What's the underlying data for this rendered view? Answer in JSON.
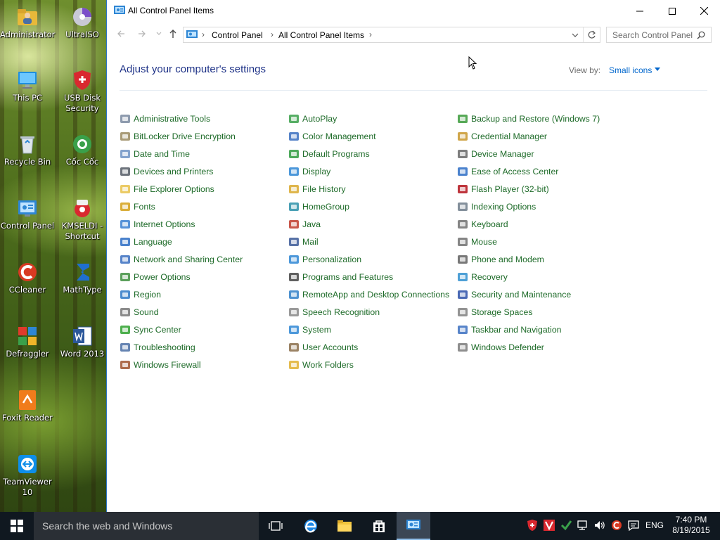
{
  "window": {
    "title": "All Control Panel Items",
    "address": [
      "Control Panel",
      "All Control Panel Items"
    ],
    "search_placeholder": "Search Control Panel",
    "heading": "Adjust your computer's settings",
    "view_by_label": "View by:",
    "view_by_value": "Small icons"
  },
  "items": {
    "col1": [
      {
        "label": "Administrative Tools",
        "icon": "admin-tools-icon",
        "color": "#7a8aa0"
      },
      {
        "label": "BitLocker Drive Encryption",
        "icon": "bitlocker-icon",
        "color": "#9a8a60"
      },
      {
        "label": "Date and Time",
        "icon": "clock-icon",
        "color": "#6f93c4"
      },
      {
        "label": "Devices and Printers",
        "icon": "printer-icon",
        "color": "#555c66"
      },
      {
        "label": "File Explorer Options",
        "icon": "folder-options-icon",
        "color": "#e7c24b"
      },
      {
        "label": "Fonts",
        "icon": "fonts-icon",
        "color": "#d4a017"
      },
      {
        "label": "Internet Options",
        "icon": "internet-options-icon",
        "color": "#3a7fd1"
      },
      {
        "label": "Language",
        "icon": "language-icon",
        "color": "#2b6cc4"
      },
      {
        "label": "Network and Sharing Center",
        "icon": "network-icon",
        "color": "#3a6fc0"
      },
      {
        "label": "Power Options",
        "icon": "power-icon",
        "color": "#3f8f3f"
      },
      {
        "label": "Region",
        "icon": "region-icon",
        "color": "#2e78c6"
      },
      {
        "label": "Sound",
        "icon": "speaker-icon",
        "color": "#777777"
      },
      {
        "label": "Sync Center",
        "icon": "sync-icon",
        "color": "#2fa12f"
      },
      {
        "label": "Troubleshooting",
        "icon": "troubleshooting-icon",
        "color": "#4a6fa5"
      },
      {
        "label": "Windows Firewall",
        "icon": "firewall-icon",
        "color": "#a0522d"
      }
    ],
    "col2": [
      {
        "label": "AutoPlay",
        "icon": "autoplay-icon",
        "color": "#3aa04a"
      },
      {
        "label": "Color Management",
        "icon": "color-management-icon",
        "color": "#3a6fc0"
      },
      {
        "label": "Default Programs",
        "icon": "default-programs-icon",
        "color": "#2f9b3f"
      },
      {
        "label": "Display",
        "icon": "display-icon",
        "color": "#2e86d4"
      },
      {
        "label": "File History",
        "icon": "file-history-icon",
        "color": "#d9a92e"
      },
      {
        "label": "HomeGroup",
        "icon": "homegroup-icon",
        "color": "#2a8fa8"
      },
      {
        "label": "Java",
        "icon": "java-icon",
        "color": "#c0392b"
      },
      {
        "label": "Mail",
        "icon": "mail-icon",
        "color": "#3b5998"
      },
      {
        "label": "Personalization",
        "icon": "personalization-icon",
        "color": "#2e86d4"
      },
      {
        "label": "Programs and Features",
        "icon": "programs-icon",
        "color": "#444444"
      },
      {
        "label": "RemoteApp and Desktop Connections",
        "icon": "remoteapp-icon",
        "color": "#2f7fc8"
      },
      {
        "label": "Speech Recognition",
        "icon": "microphone-icon",
        "color": "#888888"
      },
      {
        "label": "System",
        "icon": "system-icon",
        "color": "#2e86d4"
      },
      {
        "label": "User Accounts",
        "icon": "user-accounts-icon",
        "color": "#8a6d4a"
      },
      {
        "label": "Work Folders",
        "icon": "work-folders-icon",
        "color": "#e0b030"
      }
    ],
    "col3": [
      {
        "label": "Backup and Restore (Windows 7)",
        "icon": "backup-icon",
        "color": "#3a9a3a"
      },
      {
        "label": "Credential Manager",
        "icon": "credential-icon",
        "color": "#c8962a"
      },
      {
        "label": "Device Manager",
        "icon": "device-manager-icon",
        "color": "#666666"
      },
      {
        "label": "Ease of Access Center",
        "icon": "ease-of-access-icon",
        "color": "#2b6cc4"
      },
      {
        "label": "Flash Player (32-bit)",
        "icon": "flash-icon",
        "color": "#b3121a"
      },
      {
        "label": "Indexing Options",
        "icon": "indexing-icon",
        "color": "#6d7b8a"
      },
      {
        "label": "Keyboard",
        "icon": "keyboard-icon",
        "color": "#707070"
      },
      {
        "label": "Mouse",
        "icon": "mouse-icon",
        "color": "#707070"
      },
      {
        "label": "Phone and Modem",
        "icon": "phone-icon",
        "color": "#606060"
      },
      {
        "label": "Recovery",
        "icon": "recovery-icon",
        "color": "#2f8fcf"
      },
      {
        "label": "Security and Maintenance",
        "icon": "flag-icon",
        "color": "#2a4fa8"
      },
      {
        "label": "Storage Spaces",
        "icon": "storage-icon",
        "color": "#808080"
      },
      {
        "label": "Taskbar and Navigation",
        "icon": "taskbar-icon",
        "color": "#3a6fc0"
      },
      {
        "label": "Windows Defender",
        "icon": "defender-icon",
        "color": "#7a7a7a"
      }
    ]
  },
  "desktop": [
    {
      "label": "Administrator",
      "icon": "user-folder-icon"
    },
    {
      "label": "UltraISO",
      "icon": "ultraiso-icon"
    },
    {
      "label": "This PC",
      "icon": "computer-icon"
    },
    {
      "label": "USB Disk Security",
      "icon": "usb-security-icon"
    },
    {
      "label": "Recycle Bin",
      "icon": "recycle-bin-icon"
    },
    {
      "label": "Cốc Cốc",
      "icon": "coccoc-icon"
    },
    {
      "label": "Control Panel",
      "icon": "control-panel-icon"
    },
    {
      "label": "KMSELDI - Shortcut",
      "icon": "kmseldi-icon"
    },
    {
      "label": "CCleaner",
      "icon": "ccleaner-icon"
    },
    {
      "label": "MathType",
      "icon": "mathtype-icon"
    },
    {
      "label": "Defraggler",
      "icon": "defraggler-icon"
    },
    {
      "label": "Word 2013",
      "icon": "word-icon"
    },
    {
      "label": "Foxit Reader",
      "icon": "foxit-icon"
    },
    {
      "label": "TeamViewer 10",
      "icon": "teamviewer-icon"
    }
  ],
  "taskbar": {
    "search_placeholder": "Search the web and Windows",
    "language": "ENG",
    "time": "7:40 PM",
    "date": "8/19/2015"
  },
  "colors": {
    "link_green": "#1e6b29",
    "heading_blue": "#1e3287",
    "accent_blue": "#0066cc",
    "taskbar_bg": "#101820"
  }
}
